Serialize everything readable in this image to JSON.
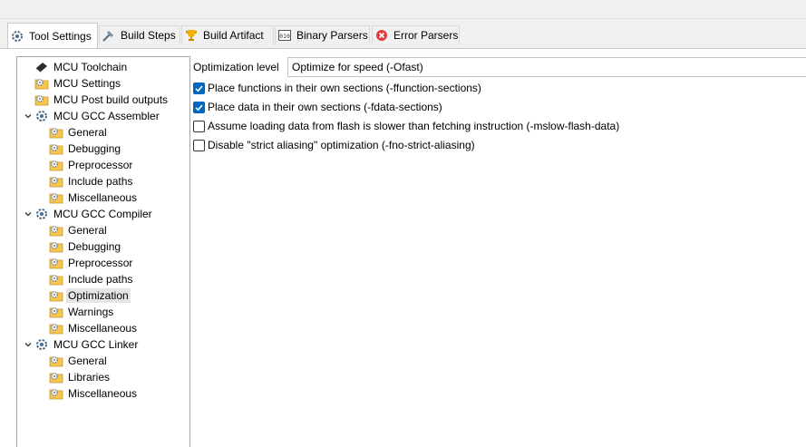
{
  "tabs": [
    {
      "label": "Tool Settings",
      "icon": "tool-settings-icon",
      "active": true
    },
    {
      "label": "Build Steps",
      "icon": "build-steps-icon",
      "active": false
    },
    {
      "label": "Build Artifact",
      "icon": "trophy-icon",
      "active": false
    },
    {
      "label": "Binary Parsers",
      "icon": "binary-icon",
      "active": false
    },
    {
      "label": "Error Parsers",
      "icon": "error-icon",
      "active": false
    }
  ],
  "tree": [
    {
      "label": "MCU Toolchain",
      "icon": "chip-icon",
      "level": 0,
      "expandable": false,
      "selected": false
    },
    {
      "label": "MCU Settings",
      "icon": "settings-folder-icon",
      "level": 0,
      "expandable": false,
      "selected": false
    },
    {
      "label": "MCU Post build outputs",
      "icon": "settings-folder-icon",
      "level": 0,
      "expandable": false,
      "selected": false
    },
    {
      "label": "MCU GCC Assembler",
      "icon": "tool-settings-icon",
      "level": 0,
      "expandable": true,
      "selected": false
    },
    {
      "label": "General",
      "icon": "settings-folder-icon",
      "level": 1,
      "expandable": false,
      "selected": false
    },
    {
      "label": "Debugging",
      "icon": "settings-folder-icon",
      "level": 1,
      "expandable": false,
      "selected": false
    },
    {
      "label": "Preprocessor",
      "icon": "settings-folder-icon",
      "level": 1,
      "expandable": false,
      "selected": false
    },
    {
      "label": "Include paths",
      "icon": "settings-folder-icon",
      "level": 1,
      "expandable": false,
      "selected": false
    },
    {
      "label": "Miscellaneous",
      "icon": "settings-folder-icon",
      "level": 1,
      "expandable": false,
      "selected": false
    },
    {
      "label": "MCU GCC Compiler",
      "icon": "tool-settings-icon",
      "level": 0,
      "expandable": true,
      "selected": false
    },
    {
      "label": "General",
      "icon": "settings-folder-icon",
      "level": 1,
      "expandable": false,
      "selected": false
    },
    {
      "label": "Debugging",
      "icon": "settings-folder-icon",
      "level": 1,
      "expandable": false,
      "selected": false
    },
    {
      "label": "Preprocessor",
      "icon": "settings-folder-icon",
      "level": 1,
      "expandable": false,
      "selected": false
    },
    {
      "label": "Include paths",
      "icon": "settings-folder-icon",
      "level": 1,
      "expandable": false,
      "selected": false
    },
    {
      "label": "Optimization",
      "icon": "settings-folder-icon",
      "level": 1,
      "expandable": false,
      "selected": true
    },
    {
      "label": "Warnings",
      "icon": "settings-folder-icon",
      "level": 1,
      "expandable": false,
      "selected": false
    },
    {
      "label": "Miscellaneous",
      "icon": "settings-folder-icon",
      "level": 1,
      "expandable": false,
      "selected": false
    },
    {
      "label": "MCU GCC Linker",
      "icon": "tool-settings-icon",
      "level": 0,
      "expandable": true,
      "selected": false
    },
    {
      "label": "General",
      "icon": "settings-folder-icon",
      "level": 1,
      "expandable": false,
      "selected": false
    },
    {
      "label": "Libraries",
      "icon": "settings-folder-icon",
      "level": 1,
      "expandable": false,
      "selected": false
    },
    {
      "label": "Miscellaneous",
      "icon": "settings-folder-icon",
      "level": 1,
      "expandable": false,
      "selected": false
    }
  ],
  "optimization": {
    "level_label": "Optimization level",
    "level_value": "Optimize for speed (-Ofast)"
  },
  "options": [
    {
      "label": "Place functions in their own sections (-ffunction-sections)",
      "checked": true
    },
    {
      "label": "Place data in their own sections (-fdata-sections)",
      "checked": true
    },
    {
      "label": "Assume loading data from flash is slower than fetching instruction (-mslow-flash-data)",
      "checked": false
    },
    {
      "label": "Disable \"strict aliasing\" optimization (-fno-strict-aliasing)",
      "checked": false
    }
  ],
  "colors": {
    "accent": "#0067c0",
    "selection": "#e5e5e5",
    "tab_background": "#f0f0f0"
  }
}
